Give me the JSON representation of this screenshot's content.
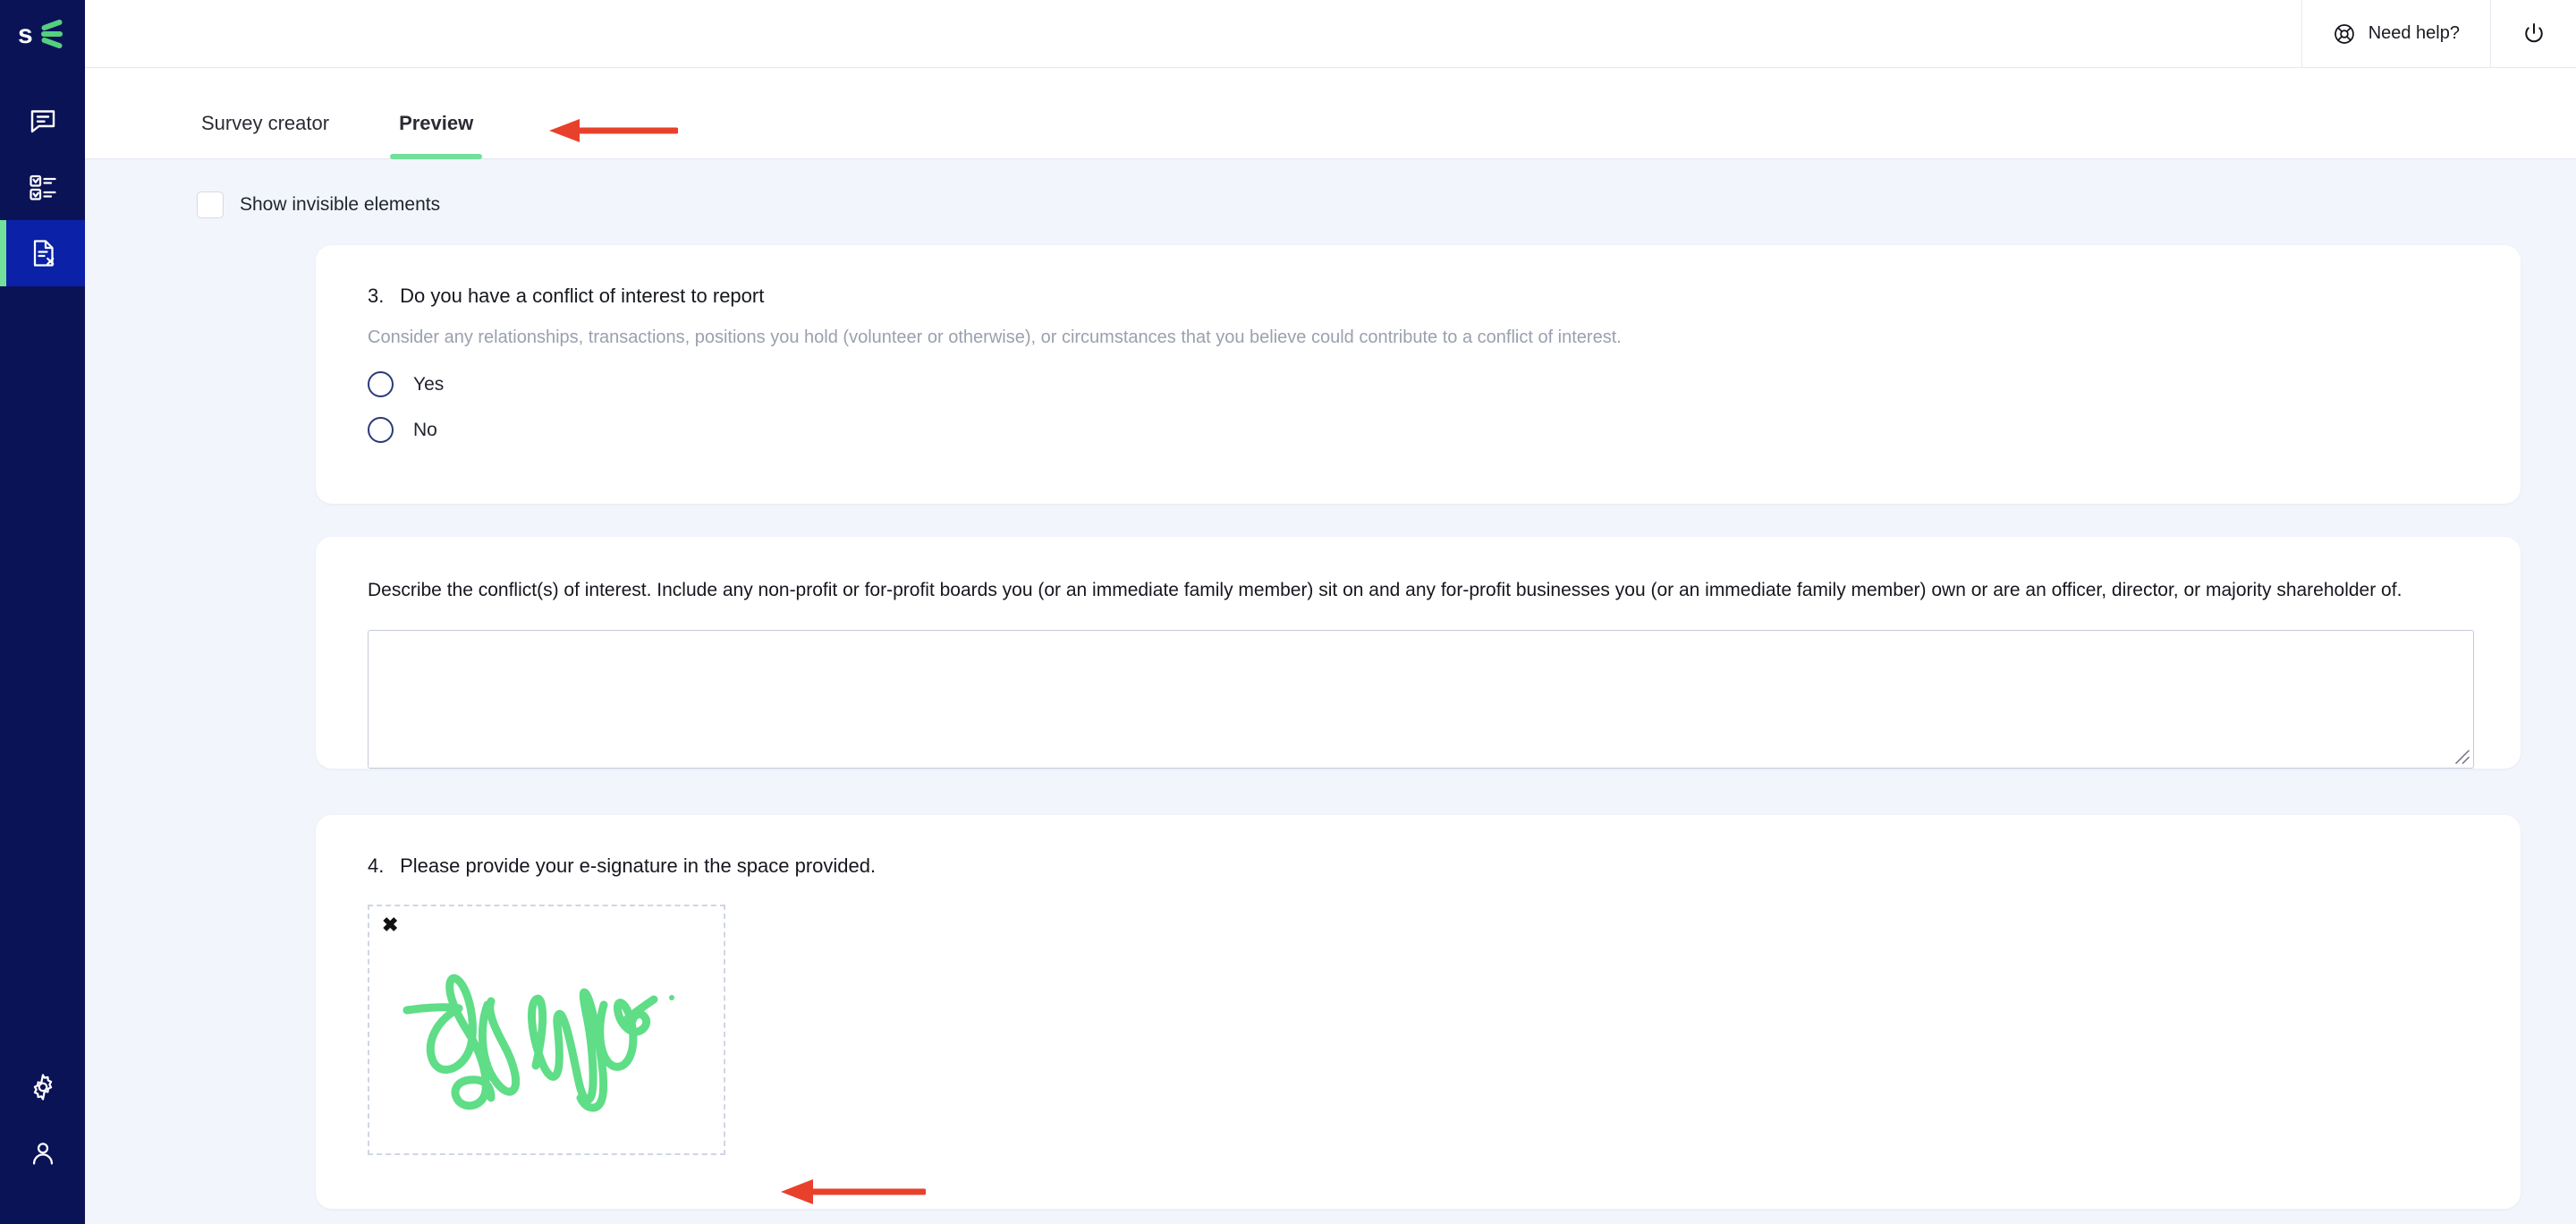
{
  "brand": {
    "logo_text": "s",
    "logo_name": "surveyjs-logo",
    "accent_green": "#72E09A",
    "sidebar_bg": "#0B1357",
    "sidebar_active_bg": "#0A21A8",
    "content_bg": "#F2F5FC",
    "annotation_red": "#E8412B",
    "signature_ink": "#5FDD87"
  },
  "sidebar": {
    "items": [
      {
        "icon": "chat-bubble-icon",
        "active": false
      },
      {
        "icon": "survey-checklist-icon",
        "active": false
      },
      {
        "icon": "document-x-icon",
        "active": true
      }
    ],
    "bottom_items": [
      {
        "icon": "gear-icon"
      },
      {
        "icon": "user-icon"
      }
    ]
  },
  "topbar": {
    "help_label": "Need help?",
    "help_icon": "lifebuoy-icon",
    "power_icon": "power-icon"
  },
  "tabs": [
    {
      "label": "Survey creator",
      "active": false
    },
    {
      "label": "Preview",
      "active": true
    }
  ],
  "toolbar": {
    "show_invisible_label": "Show invisible elements",
    "show_invisible_checked": false
  },
  "questions": [
    {
      "number": "3.",
      "title": "Do you have a conflict of interest to report",
      "description": "Consider any relationships, transactions, positions you hold (volunteer or otherwise), or circumstances that you believe could contribute to a conflict of interest.",
      "type": "radiogroup",
      "choices": [
        {
          "label": "Yes",
          "selected": false
        },
        {
          "label": "No",
          "selected": false
        }
      ]
    },
    {
      "number": "",
      "title": "Describe the conflict(s) of interest. Include any non-profit or for-profit boards you (or an immediate family member) sit on and any for-profit businesses you (or an immediate family member) own or are an officer, director, or majority shareholder of.",
      "type": "comment",
      "value": "",
      "placeholder": ""
    },
    {
      "number": "4.",
      "title": "Please provide your e-signature in the space provided.",
      "type": "signaturepad",
      "clear_label": "✖",
      "has_signature": true
    }
  ],
  "annotations": [
    {
      "name": "arrow-pointing-to-preview-tab",
      "direction": "left"
    },
    {
      "name": "arrow-pointing-to-signature-pad",
      "direction": "left"
    }
  ]
}
